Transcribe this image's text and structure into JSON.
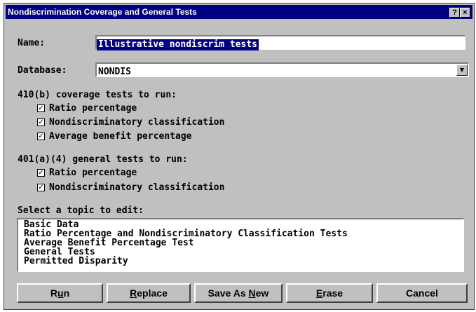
{
  "window": {
    "title": "Nondiscrimination Coverage and General Tests",
    "help_label": "?",
    "close_label": "×"
  },
  "name": {
    "label": "Name:",
    "value": "Illustrative nondiscrim tests"
  },
  "database": {
    "label": "Database:",
    "value": "NONDIS"
  },
  "coverage": {
    "heading": "410(b) coverage tests to run:",
    "items": [
      {
        "label": "Ratio percentage",
        "checked": true
      },
      {
        "label": "Nondiscriminatory classification",
        "checked": true
      },
      {
        "label": "Average benefit percentage",
        "checked": true
      }
    ]
  },
  "general": {
    "heading": "401(a)(4) general tests to run:",
    "items": [
      {
        "label": "Ratio percentage",
        "checked": true
      },
      {
        "label": "Nondiscriminatory classification",
        "checked": true
      }
    ]
  },
  "topics": {
    "heading": "Select a topic to edit:",
    "items": [
      "Basic Data",
      "Ratio Percentage and Nondiscriminatory Classification Tests",
      "Average Benefit Percentage Test",
      "General Tests",
      "Permitted Disparity"
    ]
  },
  "buttons": {
    "run": {
      "pre": "R",
      "ul": "u",
      "post": "n"
    },
    "replace": {
      "pre": "",
      "ul": "R",
      "post": "eplace"
    },
    "save_as_new": {
      "pre": "Save As ",
      "ul": "N",
      "post": "ew"
    },
    "erase": {
      "pre": "",
      "ul": "E",
      "post": "rase"
    },
    "cancel": {
      "pre": "Cancel",
      "ul": "",
      "post": ""
    }
  },
  "colors": {
    "title_bar": "#000080",
    "dialog_face": "#c0c0c0",
    "selection": "#000080"
  }
}
